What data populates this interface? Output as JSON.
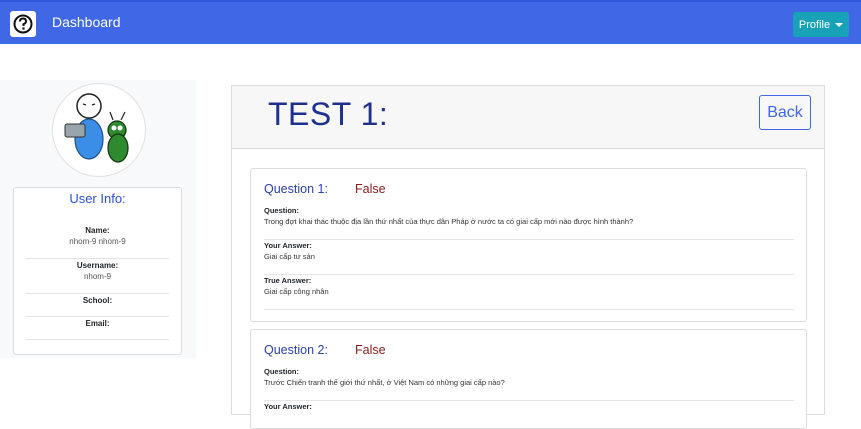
{
  "navbar": {
    "brand": "Dashboard",
    "profile_label": "Profile",
    "logo_icon": "question-mark-icon",
    "bg_color": "#3f67e6"
  },
  "user_info": {
    "title": "User Info:",
    "fields": [
      {
        "label": "Name:",
        "value": "nhom-9 nhom-9"
      },
      {
        "label": "Username:",
        "value": "nhom-9"
      },
      {
        "label": "School:",
        "value": ""
      },
      {
        "label": "Email:",
        "value": ""
      }
    ]
  },
  "test": {
    "title": "TEST 1:",
    "back_label": "Back"
  },
  "questions": [
    {
      "heading": "Question 1:",
      "status": "False",
      "question_label": "Question:",
      "question_text": "Trong đợt khai thác thuộc địa lần thứ nhất của thực dân Pháp ở nước ta có giai cấp mới nào được hình thành?",
      "your_answer_label": "Your Answer:",
      "your_answer": "Giai cấp tư sản",
      "true_answer_label": "True Answer:",
      "true_answer": "Giai cấp công nhân"
    },
    {
      "heading": "Question 2:",
      "status": "False",
      "question_label": "Question:",
      "question_text": "Trước Chiến tranh thế giới thứ nhất, ở Việt Nam có những giai cấp nào?",
      "your_answer_label": "Your Answer:"
    }
  ]
}
